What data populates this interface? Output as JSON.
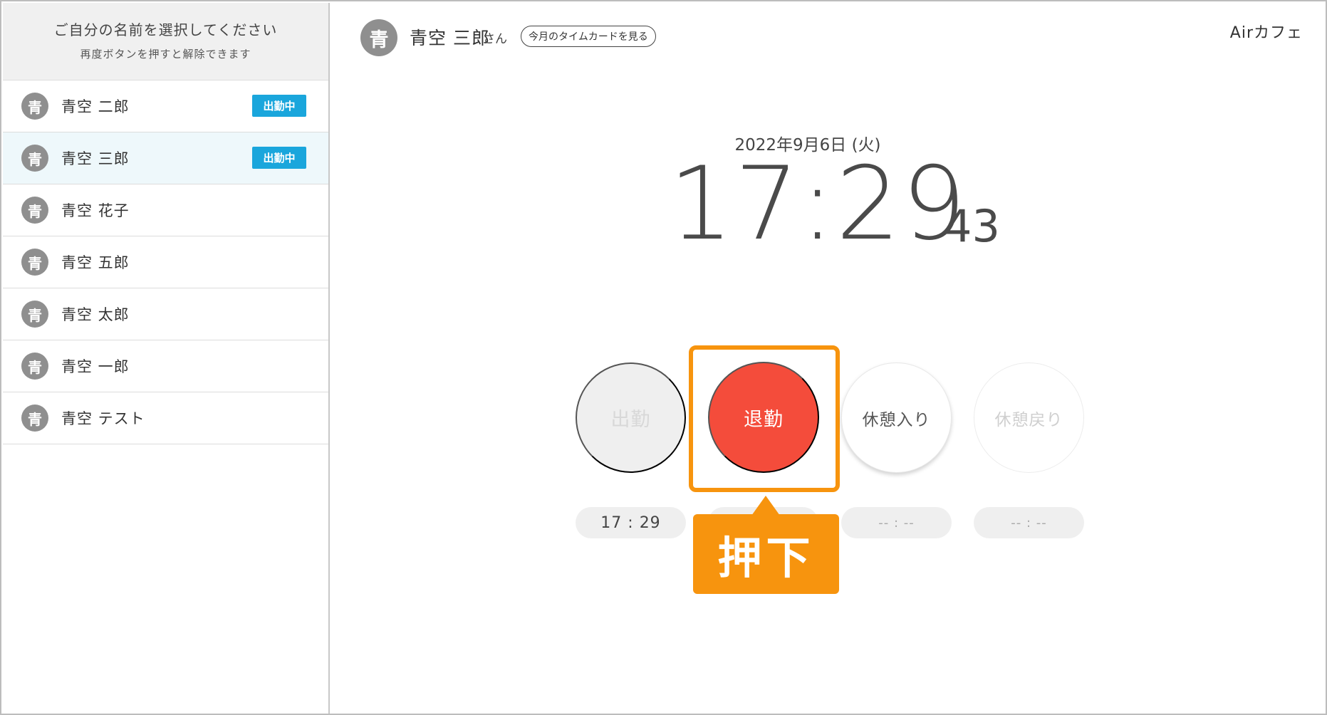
{
  "sidebar": {
    "title": "ご自分の名前を選択してください",
    "subtitle": "再度ボタンを押すと解除できます",
    "employees": [
      {
        "avatar": "青",
        "name": "青空 二郎",
        "badge": "出勤中",
        "selected": false
      },
      {
        "avatar": "青",
        "name": "青空 三郎",
        "badge": "出勤中",
        "selected": true
      },
      {
        "avatar": "青",
        "name": "青空 花子",
        "badge": "",
        "selected": false
      },
      {
        "avatar": "青",
        "name": "青空 五郎",
        "badge": "",
        "selected": false
      },
      {
        "avatar": "青",
        "name": "青空 太郎",
        "badge": "",
        "selected": false
      },
      {
        "avatar": "青",
        "name": "青空 一郎",
        "badge": "",
        "selected": false
      },
      {
        "avatar": "青",
        "name": "青空 テスト",
        "badge": "",
        "selected": false
      }
    ]
  },
  "header": {
    "avatar": "青",
    "user_name": "青空 三郎",
    "honorific": "さん",
    "timecard_label": "今月のタイムカードを見る",
    "shop_name": "Airカフェ"
  },
  "clock": {
    "date": "2022年9月6日 (火)",
    "time": "17:29",
    "seconds": "43"
  },
  "punch": {
    "clock_in_label": "出勤",
    "clock_out_label": "退勤",
    "break_start_label": "休憩入り",
    "break_end_label": "休憩戻り",
    "clock_in_time": "17 : 29",
    "clock_out_time": "",
    "break_start_time": "-- : --",
    "break_end_time": "-- : --"
  },
  "annotation": {
    "callout_text": "押下",
    "highlight_color": "#f7940e"
  },
  "colors": {
    "badge": "#1aa6dc",
    "clock_out": "#f44c3b",
    "selected_row": "#eef8fb"
  }
}
